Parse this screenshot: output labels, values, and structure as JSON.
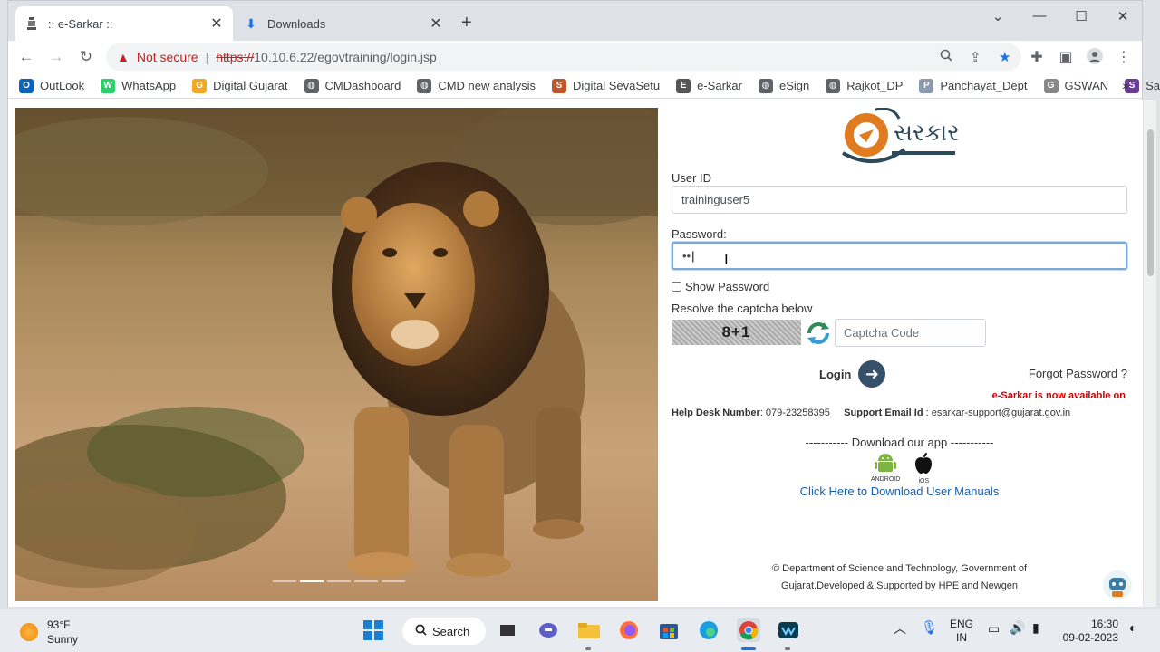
{
  "browser": {
    "tabs": [
      {
        "title": ":: e-Sarkar ::",
        "active": true
      },
      {
        "title": "Downloads",
        "active": false
      }
    ],
    "security_label": "Not secure",
    "url_scheme": "https://",
    "url_rest": "10.10.6.22/egovtraining/login.jsp",
    "bookmarks": [
      {
        "label": "OutLook",
        "icon": "outlook-icon",
        "color": "#0a64c2",
        "glyph": "O"
      },
      {
        "label": "WhatsApp",
        "icon": "whatsapp-icon",
        "color": "#25d366",
        "glyph": "W"
      },
      {
        "label": "Digital Gujarat",
        "icon": "digital-gujarat-icon",
        "color": "#f5a623",
        "glyph": "G"
      },
      {
        "label": "CMDashboard",
        "icon": "globe-icon",
        "color": "#5f6368",
        "glyph": "◍"
      },
      {
        "label": "CMD new analysis",
        "icon": "globe-icon",
        "color": "#5f6368",
        "glyph": "◍"
      },
      {
        "label": "Digital SevaSetu",
        "icon": "sevasetu-icon",
        "color": "#c0572a",
        "glyph": "S"
      },
      {
        "label": "e-Sarkar",
        "icon": "emblem-icon",
        "color": "#555555",
        "glyph": "E"
      },
      {
        "label": "eSign",
        "icon": "globe-icon",
        "color": "#5f6368",
        "glyph": "◍"
      },
      {
        "label": "Rajkot_DP",
        "icon": "globe-icon",
        "color": "#5f6368",
        "glyph": "◍"
      },
      {
        "label": "Panchayat_Dept",
        "icon": "document-icon",
        "color": "#8a9bb0",
        "glyph": "P"
      },
      {
        "label": "GSWAN",
        "icon": "gswan-icon",
        "color": "#888888",
        "glyph": "G"
      },
      {
        "label": "Sathi",
        "icon": "sathi-icon",
        "color": "#6a3d9a",
        "glyph": "S"
      }
    ],
    "more_label": "»"
  },
  "login": {
    "logo_text": "સરકાર",
    "user_id_label": "User ID",
    "user_id_value": "traininguser5",
    "password_label": "Password:",
    "password_value": "••",
    "show_password_label": "Show Password",
    "captcha_prompt": "Resolve the captcha below",
    "captcha_text": "8+1",
    "captcha_placeholder": "Captcha Code",
    "login_label": "Login",
    "forgot_label": "Forgot Password ?",
    "available_notice": "e-Sarkar is now available on",
    "helpdesk_label": "Help Desk Number",
    "helpdesk_number": ": 079-23258395",
    "support_label": "Support Email Id",
    "support_email": ": esarkar-support@gujarat.gov.in",
    "download_app": "----------- Download our app -----------",
    "android_label": "ANDROID",
    "ios_label": "iOS",
    "manuals_link": "Click Here to Download User Manuals",
    "footer_line1": "© Department of Science and Technology, Government of",
    "footer_line2": "Gujarat.Developed & Supported by HPE and Newgen"
  },
  "slider": {
    "count": 5,
    "active_index": 1
  },
  "taskbar": {
    "temperature": "93°F",
    "condition": "Sunny",
    "search_label": "Search",
    "lang_top": "ENG",
    "lang_bottom": "IN",
    "time": "16:30",
    "date": "09-02-2023"
  },
  "colors": {
    "accent": "#1a5fa8",
    "danger": "#c00000",
    "login_button": "#36506a"
  }
}
